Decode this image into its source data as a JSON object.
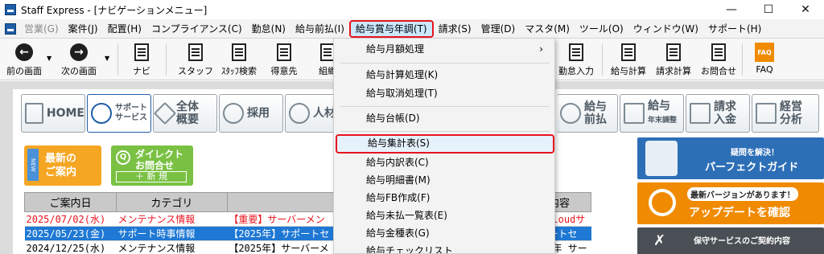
{
  "window": {
    "title": "Staff Express - [ナビゲーションメニュー]",
    "minimize": "—",
    "maximize": "☐",
    "close": "✕"
  },
  "menubar": {
    "items": [
      {
        "label": "営業(G)",
        "disabled": true
      },
      {
        "label": "案件(J)"
      },
      {
        "label": "配置(H)"
      },
      {
        "label": "コンプライアンス(C)"
      },
      {
        "label": "勤怠(N)"
      },
      {
        "label": "給与前払(I)"
      },
      {
        "label": "給与賞与年調(T)",
        "active": true
      },
      {
        "label": "請求(S)"
      },
      {
        "label": "管理(D)"
      },
      {
        "label": "マスタ(M)"
      },
      {
        "label": "ツール(O)"
      },
      {
        "label": "ウィンドウ(W)"
      },
      {
        "label": "サポート(H)"
      }
    ],
    "mdi": {
      "min": "–",
      "restore": "⧉",
      "close": "✕"
    }
  },
  "toolbar": {
    "prev": "前の画面",
    "next": "次の画面",
    "navi": "ナビ",
    "staff": "スタッフ",
    "staff_search": "ｽﾀｯﾌ検索",
    "client": "得意先",
    "org": "組織",
    "attendance_input": "勤怠入力",
    "payroll_calc": "給与計算",
    "invoice_calc": "請求計算",
    "contact": "お問合せ",
    "faq": "FAQ",
    "faq_icon_text": "FAQ"
  },
  "navtabs": {
    "home": "HOME",
    "support_1": "サポート",
    "support_2": "サービス",
    "overview_1": "全体",
    "overview_2": "概要",
    "recruit": "採用",
    "personnel": "人材",
    "advance_1": "給与",
    "advance_2": "前払",
    "yearend_1": "給与",
    "yearend_2": "年末調整",
    "billing_1": "請求",
    "billing_2": "入金",
    "analysis_1": "経営",
    "analysis_2": "分析"
  },
  "news_buttons": {
    "new_ribbon": "NEW",
    "new_1": "最新の",
    "new_2": "ご案内",
    "direct_1": "ダイレクト",
    "direct_2": "お問合せ",
    "direct_new": "＋ 新 規"
  },
  "news_table": {
    "headers": [
      "ご案内日",
      "カテゴリ",
      "",
      "内容"
    ],
    "rows": [
      {
        "date": "2025/07/02(水)",
        "category": "メンテナンス情報",
        "title": "【重要】サーバーメン",
        "content": "DB Cloudサ",
        "style": "red"
      },
      {
        "date": "2025/05/23(金)",
        "category": "サポート時事情報",
        "title": "【2025年】サポートセ",
        "content": "サポートセ",
        "style": "selected"
      },
      {
        "date": "2024/12/25(水)",
        "category": "メンテナンス情報",
        "title": "【2025年】サーバーメ",
        "content": "2025年 サー",
        "style": "normal"
      }
    ]
  },
  "side_banners": {
    "perfect_1": "疑問を解決！",
    "perfect_2": "パーフェクトガイド",
    "update_1": "最新バージョンがあります！",
    "update_2": "アップデートを確認",
    "contract": "保守サービスのご契約内容"
  },
  "dropdown": {
    "items": [
      {
        "label": "給与月額処理",
        "submenu": true
      },
      {
        "label": "給与計算処理(K)"
      },
      {
        "label": "給与取消処理(T)"
      },
      {
        "label": "給与台帳(D)"
      },
      {
        "label": "給与集計表(S)",
        "highlight": true
      },
      {
        "label": "給与内訳表(C)"
      },
      {
        "label": "給与明細書(M)"
      },
      {
        "label": "給与FB作成(F)"
      },
      {
        "label": "給与未払一覧表(E)"
      },
      {
        "label": "給与金種表(G)"
      },
      {
        "label": "給与チェックリスト"
      }
    ],
    "submenu_arrow": "›"
  },
  "colors": {
    "highlight_border": "#e8141d",
    "selection_blue": "#1e78d4",
    "brand_blue": "#1f5ea8"
  }
}
